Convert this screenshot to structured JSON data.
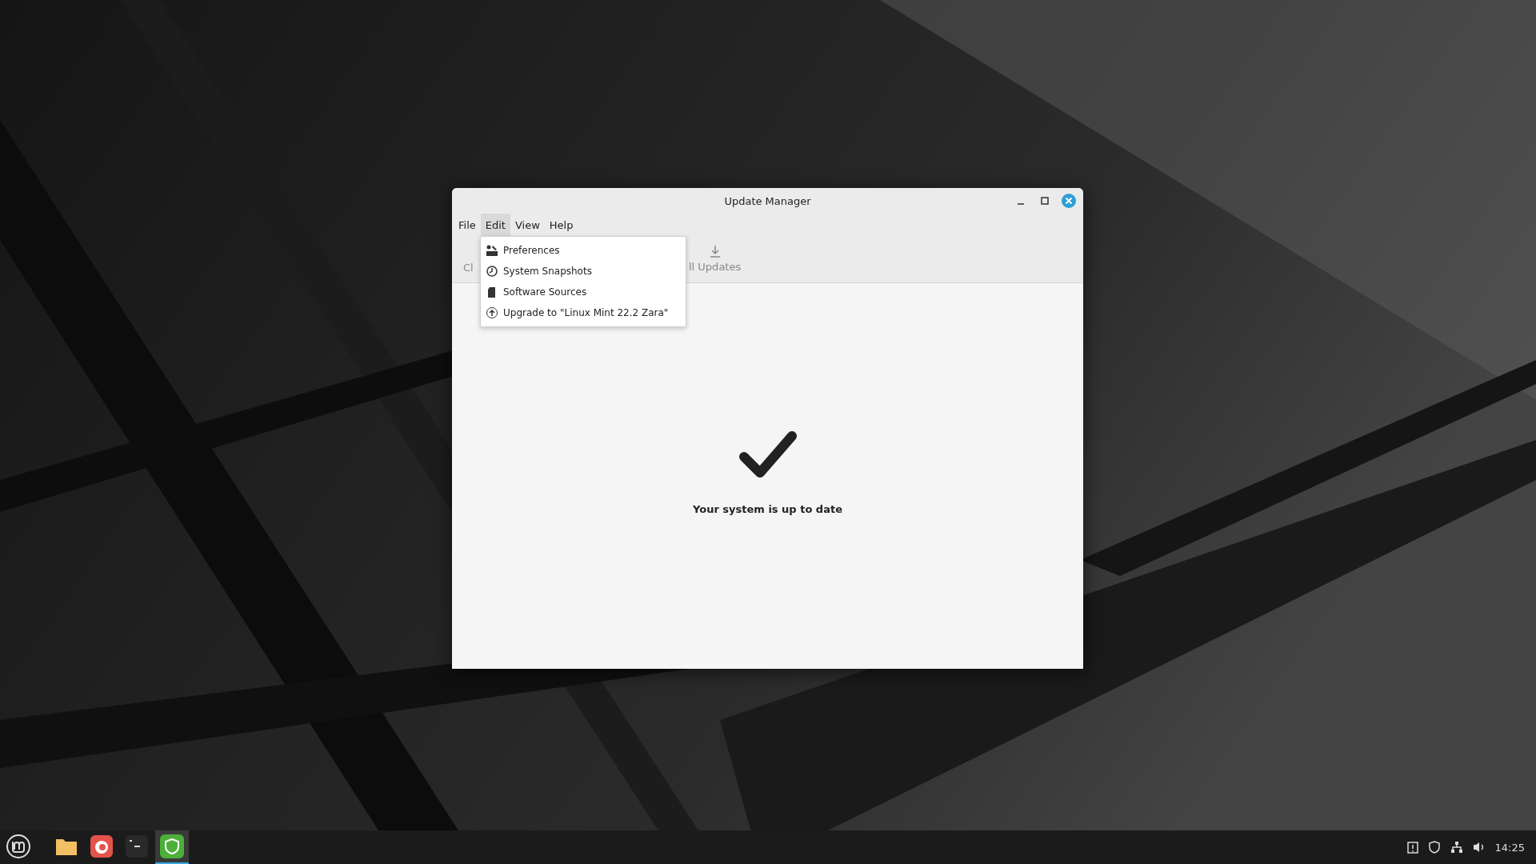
{
  "window": {
    "title": "Update Manager"
  },
  "menubar": [
    {
      "label": "File",
      "selected": false
    },
    {
      "label": "Edit",
      "selected": true
    },
    {
      "label": "View",
      "selected": false
    },
    {
      "label": "Help",
      "selected": false
    }
  ],
  "toolbar": [
    {
      "label": "Cl",
      "kind": "plain"
    },
    {
      "label": "ll Updates",
      "kind": "download"
    }
  ],
  "edit_menu": [
    {
      "label": "Preferences",
      "kind": "preferences"
    },
    {
      "label": "System Snapshots",
      "kind": "snapshots"
    },
    {
      "label": "Software Sources",
      "kind": "sources"
    },
    {
      "label": "Upgrade to \"Linux Mint 22.2 Zara\"",
      "kind": "upgrade"
    }
  ],
  "status": {
    "message": "Your system is up to date"
  },
  "taskbar": {
    "apps": [
      {
        "kind": "files",
        "selected": false
      },
      {
        "kind": "firefox",
        "selected": false
      },
      {
        "kind": "terminal",
        "selected": false
      },
      {
        "kind": "shield",
        "selected": true
      }
    ],
    "clock": "14:25"
  }
}
